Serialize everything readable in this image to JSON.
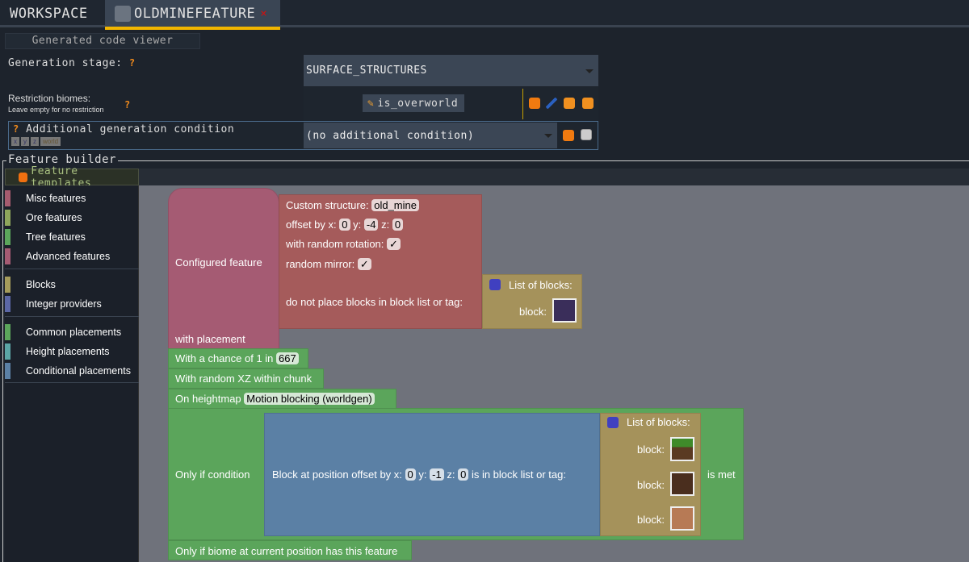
{
  "tabs": [
    {
      "label": "WORKSPACE"
    },
    {
      "label": "OLDMINEFEATURE",
      "close": "×"
    }
  ],
  "code_viewer": "Generated code viewer",
  "generation_stage": {
    "label": "Generation stage:",
    "help": "?",
    "value": "SURFACE_STRUCTURES"
  },
  "restriction": {
    "label": "Restriction biomes:",
    "sub": "Leave empty for no restriction",
    "help": "?",
    "biome": "is_overworld"
  },
  "condition": {
    "help": "?",
    "label": "Additional generation condition",
    "deps": [
      "x",
      "y",
      "z",
      "world"
    ],
    "value": "(no additional condition)"
  },
  "builder": {
    "legend": "Feature builder",
    "palette_title": "Feature templates",
    "categories": [
      {
        "label": "Misc features",
        "color": "#a55b6e"
      },
      {
        "label": "Ore features",
        "color": "#8ea55b"
      },
      {
        "label": "Tree features",
        "color": "#5ba55b"
      },
      {
        "label": "Advanced features",
        "color": "#a55b73"
      },
      {
        "label": "Blocks",
        "color": "#a59c5b"
      },
      {
        "label": "Integer providers",
        "color": "#5b67a5"
      },
      {
        "label": "Common placements",
        "color": "#5ba55b"
      },
      {
        "label": "Height placements",
        "color": "#5ba5a5"
      },
      {
        "label": "Conditional placements",
        "color": "#5b80a5"
      }
    ]
  },
  "blocks": {
    "configured": {
      "label": "Configured feature",
      "placement": "with placement"
    },
    "structure": {
      "label": "Custom structure:",
      "name": "old_mine",
      "offset": "offset by x:",
      "x": "0",
      "y_label": "y:",
      "y": "-4",
      "z_label": "z:",
      "z": "0",
      "rotation": "with random rotation:",
      "mirror": "random mirror:",
      "check": "✓",
      "ignore": "do not place blocks in block list or tag:"
    },
    "list1": {
      "title": "List of blocks:",
      "block": "block:"
    },
    "chance": {
      "label": "With a chance of 1 in",
      "value": "667"
    },
    "random_xz": "With random XZ within chunk",
    "heightmap": {
      "label": "On heightmap",
      "value": "Motion blocking (worldgen)"
    },
    "only_if": {
      "label": "Only if condition",
      "is_met": "is met"
    },
    "block_at": {
      "label": "Block at position offset by x:",
      "x": "0",
      "y_label": "y:",
      "y": "-1",
      "z_label": "z:",
      "z": "0",
      "suffix": "is in block list or tag:"
    },
    "list2": {
      "title": "List of blocks:",
      "blocks": [
        "block:",
        "block:",
        "block:"
      ]
    },
    "biome_check": "Only if biome at current position has this feature"
  },
  "colors": {
    "accent": "#f2b600",
    "feature": "#a55b73",
    "structure": "#a55b5b",
    "list": "#a5925b",
    "placement": "#5ba55b",
    "condition": "#5b80a5"
  }
}
